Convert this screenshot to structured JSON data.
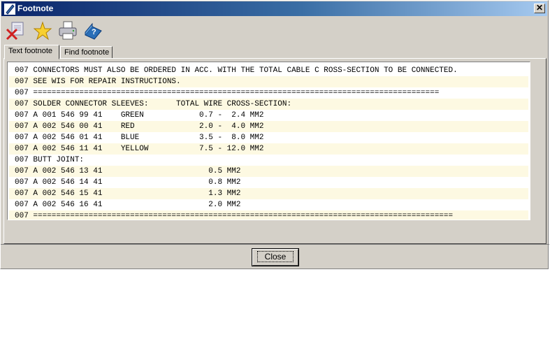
{
  "window": {
    "title": "Footnote",
    "close_glyph": "✕"
  },
  "toolbar": {
    "icons": [
      "remove-footnote-icon",
      "favorite-star-icon",
      "printer-icon",
      "help-book-icon"
    ]
  },
  "tabs": [
    {
      "label": "Text footnote",
      "active": true
    },
    {
      "label": "Find footnote",
      "active": false
    }
  ],
  "footnote_lines": [
    "007 CONNECTORS MUST ALSO BE ORDERED IN ACC. WITH THE TOTAL CABLE C ROSS-SECTION TO BE CONNECTED.",
    "007 SEE WIS FOR REPAIR INSTRUCTIONS.",
    "007 ========================================================================================",
    "007 SOLDER CONNECTOR SLEEVES:      TOTAL WIRE CROSS-SECTION:",
    "007 A 001 546 99 41    GREEN            0.7 -  2.4 MM2",
    "007 A 002 546 00 41    RED              2.0 -  4.0 MM2",
    "007 A 002 546 01 41    BLUE             3.5 -  8.0 MM2",
    "007 A 002 546 11 41    YELLOW           7.5 - 12.0 MM2",
    "007 BUTT JOINT:",
    "007 A 002 546 13 41                       0.5 MM2",
    "007 A 002 546 14 41                       0.8 MM2",
    "007 A 002 546 15 41                       1.3 MM2",
    "007 A 002 546 16 41                       2.0 MM2",
    "007 ==========================================================================================="
  ],
  "buttons": {
    "close_label": "Close"
  },
  "colors": {
    "row_shade": "#fdf9e2",
    "title_start": "#0a246a",
    "title_end": "#a6caf0"
  }
}
